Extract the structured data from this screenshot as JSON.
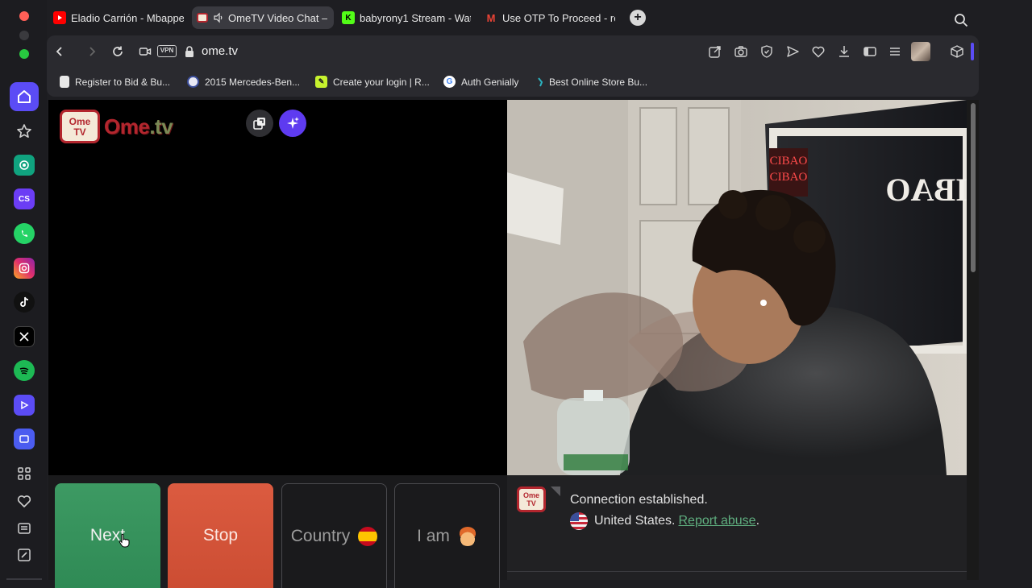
{
  "sidebar": {
    "apps": [
      {
        "name": "home",
        "color": "#5b4cf5"
      },
      {
        "name": "bookmarks-star"
      },
      {
        "name": "chatgpt",
        "color": "#10a37f"
      },
      {
        "name": "cs-app",
        "label": "CS",
        "color": "#6b3df5"
      },
      {
        "name": "whatsapp",
        "color": "#25d366"
      },
      {
        "name": "instagram",
        "color": "#e1306c"
      },
      {
        "name": "tiktok",
        "color": "#111111"
      },
      {
        "name": "x",
        "color": "#000000"
      },
      {
        "name": "spotify",
        "color": "#1db954"
      },
      {
        "name": "player",
        "color": "#5b4cf5"
      },
      {
        "name": "cast",
        "color": "#4b5cf0"
      }
    ]
  },
  "tabs": [
    {
      "title": "Eladio Carrión - Mbappe",
      "favicon": "youtube-icon",
      "color": "#ff0000"
    },
    {
      "title": "OmeTV Video Chat –",
      "favicon": "ometv-icon",
      "active": true
    },
    {
      "title": "babyrony1 Stream - Wat",
      "favicon": "kick-icon",
      "color": "#53fc18",
      "fav_label": "K"
    },
    {
      "title": "Use OTP To Proceed - ro",
      "favicon": "gmail-icon",
      "color": "#ea4335",
      "fav_label": "M"
    }
  ],
  "address": {
    "vpn_label": "VPN",
    "url": "ome.tv"
  },
  "bookmarks": [
    {
      "label": "Register to Bid & Bu...",
      "icon": "document-icon"
    },
    {
      "label": "2015 Mercedes-Ben...",
      "icon": "badge-icon"
    },
    {
      "label": "Create your login | R...",
      "icon": "pencil-icon"
    },
    {
      "label": "Auth Genially",
      "icon": "google-icon"
    },
    {
      "label": "Best Online Store Bu...",
      "icon": "store-icon"
    }
  ],
  "site": {
    "logo_badge_top": "Ome",
    "logo_badge_bottom": "TV",
    "logo_text_main": "Ome",
    "logo_text_suffix": ".tv"
  },
  "controls": {
    "next_label": "Next",
    "stop_label": "Stop",
    "country_label": "Country",
    "iam_label": "I am",
    "country_flag": "spain-flag-icon",
    "gender_icon": "boy-face-icon"
  },
  "chat": {
    "icon_top": "Ome",
    "icon_bottom": "TV",
    "message_1": "Connection established.",
    "message_2_country": "United States.",
    "report_link": "Report abuse",
    "message_2_end": "."
  },
  "remote_video": {
    "sign_text": "CIBAO",
    "red_sign_lines": [
      "CIBAO",
      "CIBAO"
    ]
  }
}
